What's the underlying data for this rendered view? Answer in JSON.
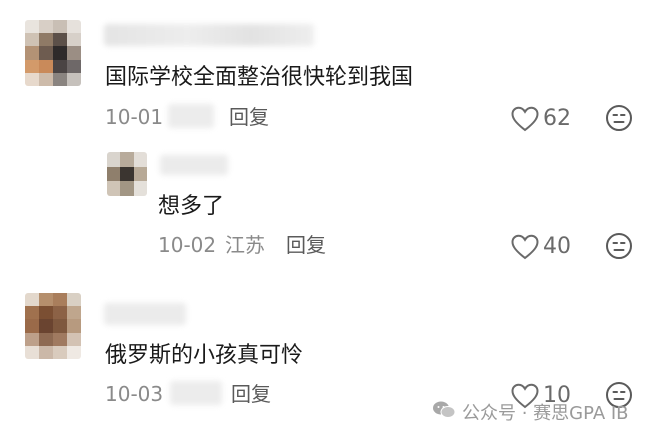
{
  "comments": [
    {
      "text": "国际学校全面整治很快轮到我国",
      "date": "10-01",
      "reply_label": "回复",
      "likes": "62",
      "reply": {
        "text": "想多了",
        "date": "10-02",
        "location": "江苏",
        "reply_label": "回复",
        "likes": "40"
      }
    },
    {
      "text": "俄罗斯的小孩真可怜",
      "date": "10-03",
      "reply_label": "回复",
      "likes": "10"
    }
  ],
  "watermark": {
    "text": "公众号 · 赛思GPA IB",
    "icon": "wechat-icon"
  },
  "icons": {
    "like": "heart-outline-icon",
    "react": "neutral-face-icon"
  }
}
